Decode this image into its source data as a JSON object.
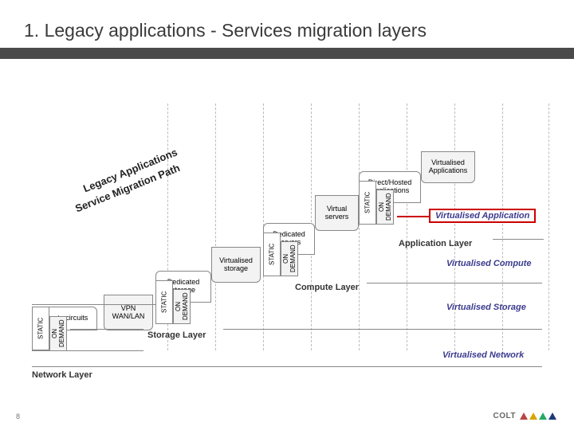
{
  "title": "1. Legacy applications - Services migration layers",
  "diag1": "Legacy Applications",
  "diag2": "Service Migration Path",
  "boxes": {
    "private_circuits": "Private circuits",
    "vpn": "VPN WAN/LAN",
    "ded_storage": "Dedicated storage",
    "virt_storage": "Virtualised storage",
    "ded_servers": "Dedicated servers",
    "virt_servers": "Virtual servers",
    "direct_hosted": "Direct/Hosted Applications",
    "virt_apps": "Virtualised Applications"
  },
  "tags": {
    "static": "STATIC",
    "od": "ON DEMAND"
  },
  "labels": {
    "virt_application": "Virtualised Application",
    "app_layer": "Application Layer",
    "virt_compute": "Virtualised Compute",
    "compute_layer": "Compute Layer",
    "virt_storage": "Virtualised Storage",
    "storage_layer": "Storage Layer",
    "virt_network": "Virtualised Network",
    "network_layer": "Network Layer"
  },
  "page": "8",
  "brand": "COLT"
}
